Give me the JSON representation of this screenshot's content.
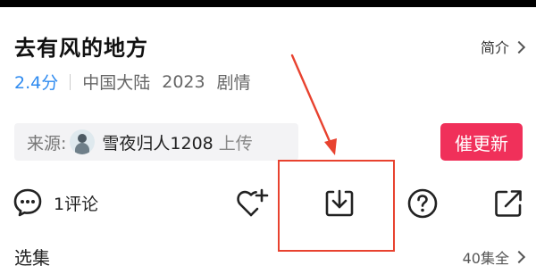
{
  "title": "去有风的地方",
  "intro_label": "简介",
  "meta": {
    "score": "2.4分",
    "region": "中国大陆",
    "year": "2023",
    "genre": "剧情"
  },
  "source": {
    "label": "来源:",
    "user": "雪夜归人1208",
    "action": "上传"
  },
  "urge_button": "催更新",
  "actions": {
    "comment_label": "1评论",
    "icons": [
      "comment-icon",
      "heart-plus-icon",
      "download-icon",
      "help-icon",
      "share-icon"
    ]
  },
  "episodes": {
    "section_label": "选集",
    "summary": "40集全"
  },
  "colors": {
    "accent_pink": "#f0305a",
    "score_blue": "#2f8bf0",
    "annotation_red": "#e8422f"
  }
}
